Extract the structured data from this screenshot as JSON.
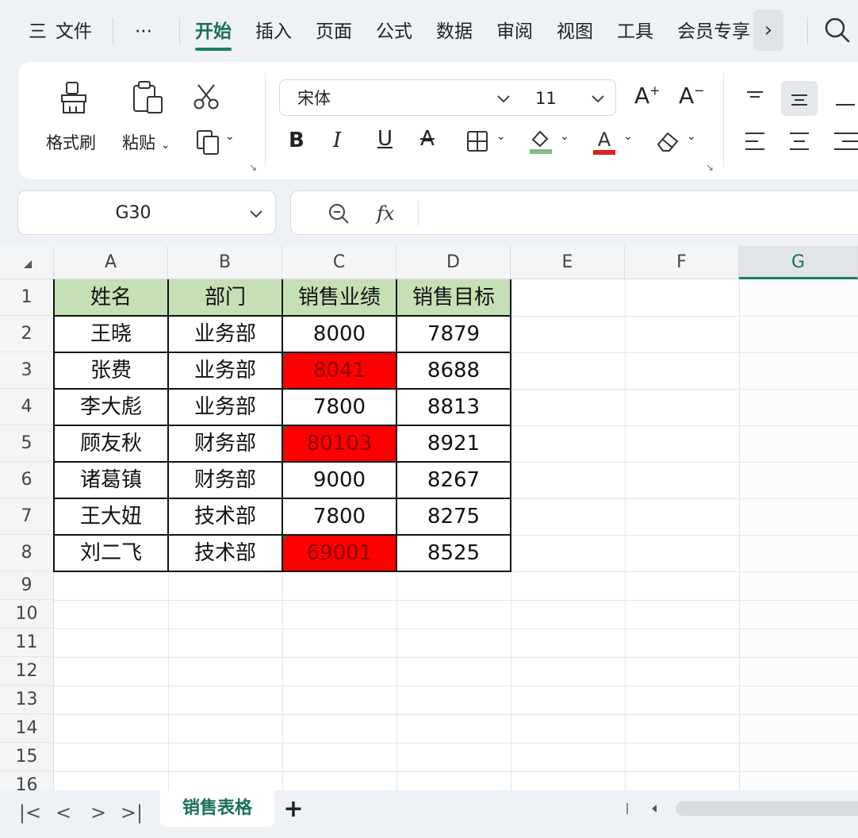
{
  "menu": {
    "hamburger": "三",
    "file": "文件",
    "more": "···",
    "tabs": [
      "开始",
      "插入",
      "页面",
      "公式",
      "数据",
      "审阅",
      "视图",
      "工具",
      "会员专享"
    ],
    "active_tab": "开始",
    "more_tabs": "›"
  },
  "ribbon": {
    "format_painter": "格式刷",
    "paste": "粘贴",
    "font_name": "宋体",
    "font_size": "11",
    "bold": "B",
    "italic": "I",
    "underline": "U",
    "strike": "A",
    "grow": "A",
    "shrink": "A",
    "font_color": "A",
    "fill_color_hex": "#7fbf7f",
    "font_color_hex": "#e02020"
  },
  "formula": {
    "cell_ref": "G30",
    "fx": "fx",
    "value": ""
  },
  "grid": {
    "columns": [
      "A",
      "B",
      "C",
      "D",
      "E",
      "F",
      "G"
    ],
    "selected_column": "G",
    "rows": [
      "1",
      "2",
      "3",
      "4",
      "5",
      "6",
      "7",
      "8",
      "9",
      "10",
      "11",
      "12",
      "13",
      "14",
      "15",
      "16"
    ],
    "table": {
      "headers": [
        "姓名",
        "部门",
        "销售业绩",
        "销售目标"
      ],
      "rows": [
        [
          "王晓",
          "业务部",
          "8000",
          "7879"
        ],
        [
          "张费",
          "业务部",
          "8041",
          "8688"
        ],
        [
          "李大彪",
          "业务部",
          "7800",
          "8813"
        ],
        [
          "顾友秋",
          "财务部",
          "80103",
          "8921"
        ],
        [
          "诸葛镇",
          "财务部",
          "9000",
          "8267"
        ],
        [
          "王大妞",
          "技术部",
          "7800",
          "8275"
        ],
        [
          "刘二飞",
          "技术部",
          "69001",
          "8525"
        ]
      ],
      "highlighted_cells": [
        "C3",
        "C5",
        "C8"
      ],
      "header_fill": "#c5e0b4",
      "highlight_fill": "#ff0000"
    }
  },
  "sheets": {
    "nav": [
      "|<",
      "<",
      ">",
      ">|"
    ],
    "tabs": [
      "销售表格"
    ],
    "add": "+"
  }
}
